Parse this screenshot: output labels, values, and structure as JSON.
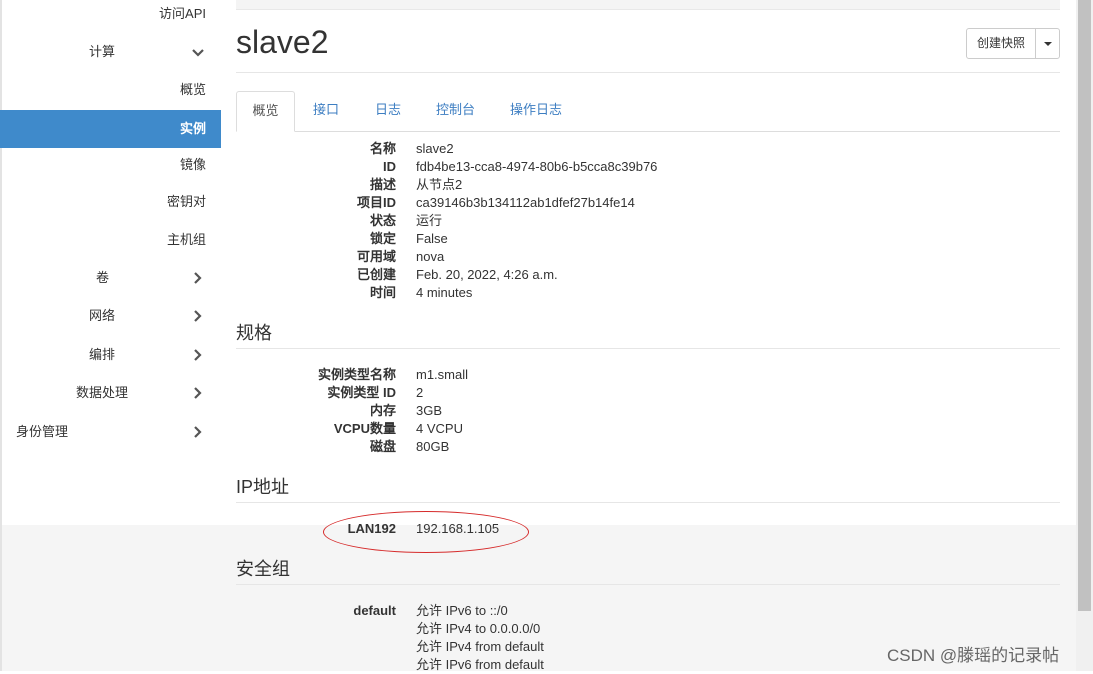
{
  "sidebar": {
    "items": [
      {
        "label": "访问API"
      },
      {
        "label": "计算"
      },
      {
        "label": "概览"
      },
      {
        "label": "实例"
      },
      {
        "label": "镜像"
      },
      {
        "label": "密钥对"
      },
      {
        "label": "主机组"
      },
      {
        "label": "卷"
      },
      {
        "label": "网络"
      },
      {
        "label": "编排"
      },
      {
        "label": "数据处理"
      },
      {
        "label": "身份管理"
      }
    ]
  },
  "header": {
    "title": "slave2",
    "snapshot_button": "创建快照"
  },
  "tabs": [
    {
      "label": "概览",
      "active": true
    },
    {
      "label": "接口"
    },
    {
      "label": "日志"
    },
    {
      "label": "控制台"
    },
    {
      "label": "操作日志"
    }
  ],
  "overview": [
    {
      "label": "名称",
      "value": "slave2"
    },
    {
      "label": "ID",
      "value": "fdb4be13-cca8-4974-80b6-b5cca8c39b76"
    },
    {
      "label": "描述",
      "value": "从节点2"
    },
    {
      "label": "项目ID",
      "value": "ca39146b3b134112ab1dfef27b14fe14"
    },
    {
      "label": "状态",
      "value": "运行"
    },
    {
      "label": "锁定",
      "value": "False"
    },
    {
      "label": "可用域",
      "value": "nova"
    },
    {
      "label": "已创建",
      "value": "Feb. 20, 2022, 4:26 a.m."
    },
    {
      "label": "时间",
      "value": "4 minutes"
    }
  ],
  "specs": {
    "title": "规格",
    "rows": [
      {
        "label": "实例类型名称",
        "value": "m1.small"
      },
      {
        "label": "实例类型 ID",
        "value": "2"
      },
      {
        "label": "内存",
        "value": "3GB"
      },
      {
        "label": "VCPU数量",
        "value": "4 VCPU"
      },
      {
        "label": "磁盘",
        "value": "80GB"
      }
    ]
  },
  "ip": {
    "title": "IP地址",
    "rows": [
      {
        "label": "LAN192",
        "value": "192.168.1.105"
      }
    ]
  },
  "security": {
    "title": "安全组",
    "group": "default",
    "rules": [
      "允许 IPv6 to ::/0",
      "允许 IPv4 to 0.0.0.0/0",
      "允许 IPv4 from default",
      "允许 IPv6 from default"
    ]
  },
  "watermark": "CSDN @滕瑶的记录帖",
  "colors": {
    "active_nav": "#3f8acb",
    "link": "#3d7ec2",
    "annotation": "#d62b2b"
  }
}
